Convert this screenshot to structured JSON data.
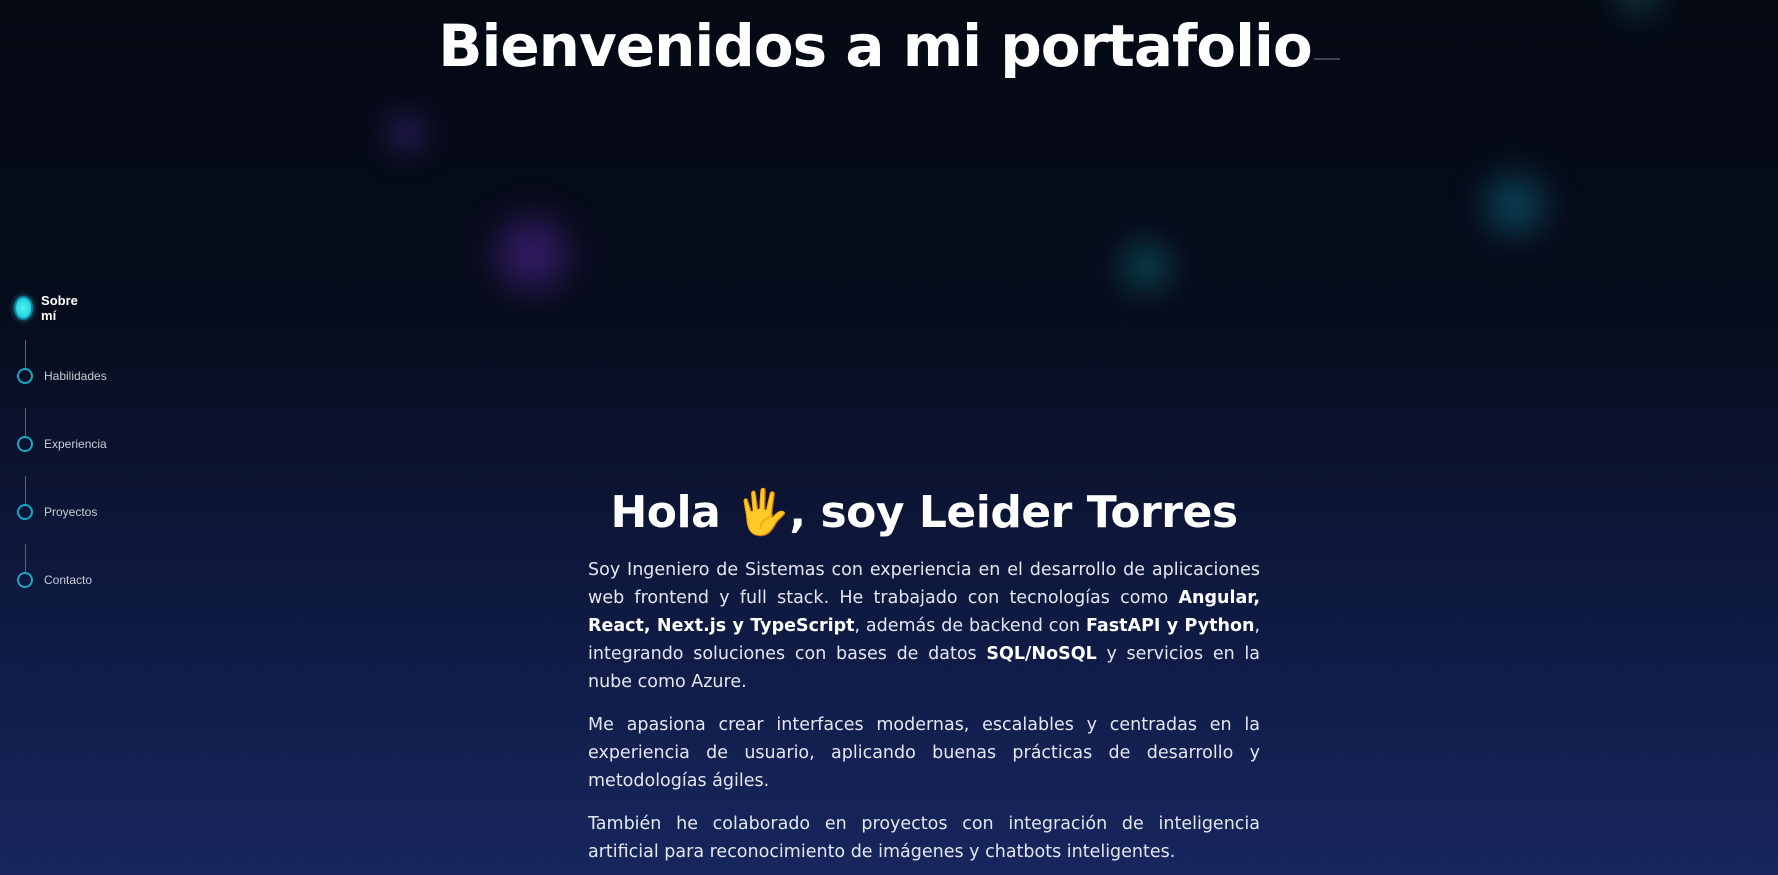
{
  "header": {
    "title": "Bienvenidos a mi portafolio"
  },
  "timeline": {
    "items": [
      {
        "label": "Sobre mí",
        "active": true
      },
      {
        "label": "Habilidades",
        "active": false
      },
      {
        "label": "Experiencia",
        "active": false
      },
      {
        "label": "Proyectos",
        "active": false
      },
      {
        "label": "Contacto",
        "active": false
      }
    ],
    "accent_color": "#24d4de"
  },
  "about": {
    "greeting_start": "Hola",
    "greeting_emoji": "🖐",
    "greeting_end": ", soy Leider Torres",
    "p1": {
      "t1": "Soy Ingeniero de Sistemas con experiencia en el desarrollo de aplicaciones web frontend y full stack. He trabajado con tecnologías como ",
      "b1": "Angular, React, Next.js y TypeScript",
      "t2": ", además de backend con ",
      "b2": "FastAPI y Python",
      "t3": ", integrando soluciones con bases de datos ",
      "b3": "SQL/NoSQL",
      "t4": " y servicios en la nube como Azure."
    },
    "p2": "Me apasiona crear interfaces modernas, escalables y centradas en la experiencia de usuario, aplicando buenas prácticas de desarrollo y metodologías ágiles.",
    "p3": "También he colaborado en proyectos con integración de inteligencia artificial para reconocimiento de imágenes y chatbots inteligentes."
  },
  "theme": {
    "background_top": "#050914",
    "background_bottom": "#17265e",
    "text_color": "#ffffff"
  }
}
